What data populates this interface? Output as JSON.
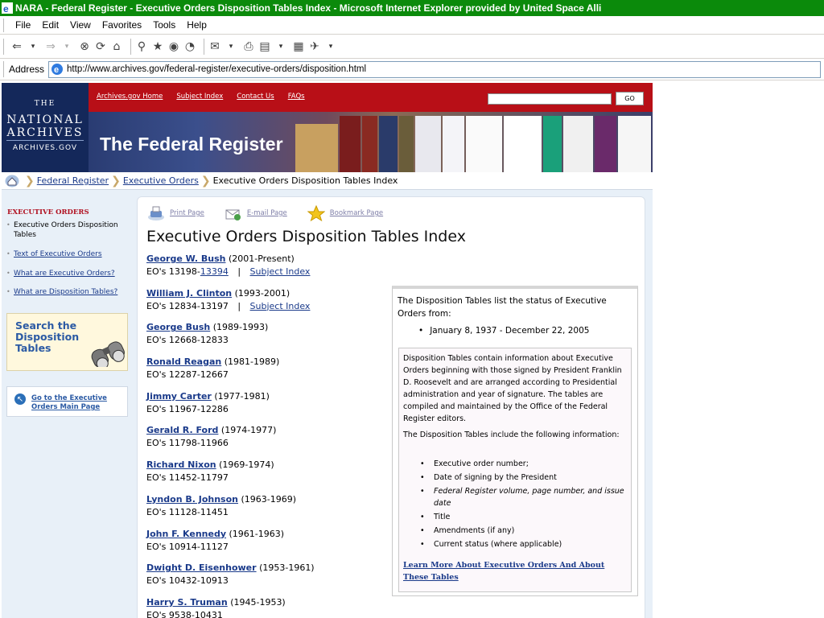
{
  "browser": {
    "title": "NARA - Federal Register - Executive Orders Disposition Tables Index - Microsoft Internet Explorer provided by United Space Alli",
    "menu": [
      "File",
      "Edit",
      "View",
      "Favorites",
      "Tools",
      "Help"
    ],
    "address_label": "Address",
    "url": "http://www.archives.gov/federal-register/executive-orders/disposition.html"
  },
  "header": {
    "logo_the": "THE",
    "logo_line1": "NATIONAL",
    "logo_line2": "ARCHIVES",
    "logo_gov": "ARCHIVES.GOV",
    "links": [
      "Archives.gov Home",
      "Subject Index",
      "Contact Us",
      "FAQs"
    ],
    "go_label": "GO",
    "banner_title": "The Federal Register"
  },
  "breadcrumb": {
    "items": [
      "Federal Register",
      "Executive Orders"
    ],
    "current": "Executive Orders Disposition Tables Index"
  },
  "sidebar": {
    "heading": "EXECUTIVE ORDERS",
    "items": [
      {
        "label": "Executive Orders Disposition Tables"
      },
      {
        "label": "Text of Executive Orders"
      },
      {
        "label": "What are Executive Orders?"
      },
      {
        "label": "What are Disposition Tables?"
      }
    ],
    "search_text": "Search the Disposition Tables",
    "goto_label": "Go to the Executive Orders Main Page"
  },
  "tools": {
    "print": "Print Page",
    "email": "E-mail Page",
    "bookmark": "Bookmark Page"
  },
  "page_title": "Executive Orders Disposition Tables Index",
  "presidents": [
    {
      "name": "George W. Bush",
      "years": "(2001-Present)",
      "eo_prefix": "EO's 13198-",
      "eo_link": "13394",
      "sep": "|",
      "subject": "Subject Index"
    },
    {
      "name": "William J. Clinton",
      "years": "(1993-2001)",
      "eo": "EO's 12834-13197",
      "sep": "|",
      "subject": "Subject Index"
    },
    {
      "name": "George Bush",
      "years": "(1989-1993)",
      "eo": "EO's 12668-12833"
    },
    {
      "name": "Ronald Reagan",
      "years": "(1981-1989)",
      "eo": "EO's 12287-12667"
    },
    {
      "name": "Jimmy Carter",
      "years": "(1977-1981)",
      "eo": "EO's 11967-12286"
    },
    {
      "name": "Gerald R. Ford",
      "years": "(1974-1977)",
      "eo": "EO's 11798-11966"
    },
    {
      "name": "Richard Nixon",
      "years": "(1969-1974)",
      "eo": "EO's 11452-11797"
    },
    {
      "name": "Lyndon B. Johnson",
      "years": "(1963-1969)",
      "eo": "EO's 11128-11451"
    },
    {
      "name": "John F. Kennedy",
      "years": "(1961-1963)",
      "eo": "EO's 10914-11127"
    },
    {
      "name": "Dwight D. Eisenhower",
      "years": "(1953-1961)",
      "eo": "EO's 10432-10913"
    },
    {
      "name": "Harry S. Truman",
      "years": "(1945-1953)",
      "eo": "EO's 9538-10431"
    }
  ],
  "disposition": {
    "intro": "The Disposition Tables list the status of Executive Orders from:",
    "range": "January 8, 1937 - December 22, 2005",
    "p1": "Disposition Tables contain information about Executive Orders beginning with those signed by President Franklin D. Roosevelt and are arranged according to Presidential administration and year of signature. The tables are compiled and maintained by the Office of the Federal Register editors.",
    "p2": "The Disposition Tables include the following information:",
    "items": [
      "Executive order number;",
      "Date of signing by the President",
      "Federal Register volume, page number, and issue date",
      "Title",
      "Amendments (if any)",
      "Current status (where applicable)"
    ],
    "learn_more": "Learn More About Executive Orders And About These Tables"
  }
}
